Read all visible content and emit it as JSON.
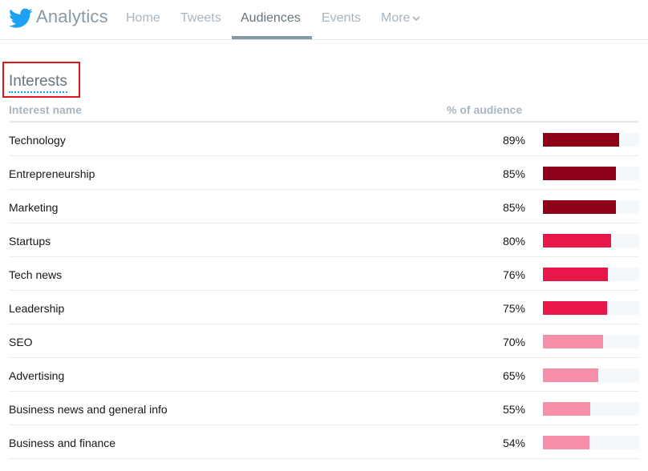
{
  "nav": {
    "brand": "Analytics",
    "links": [
      "Home",
      "Tweets",
      "Audiences",
      "Events",
      "More"
    ],
    "active": "Audiences"
  },
  "section": {
    "title": "Interests",
    "col_name": "Interest name",
    "col_pct": "% of audience"
  },
  "colors": {
    "dark": "#8f0018",
    "mid": "#e8174a",
    "light": "#f68fa8",
    "track": "#f5f8fa"
  },
  "interests": [
    {
      "name": "Technology",
      "pct_label": "89%",
      "value": 0.89,
      "tier": "dark"
    },
    {
      "name": "Entrepreneurship",
      "pct_label": "85%",
      "value": 0.85,
      "tier": "dark"
    },
    {
      "name": "Marketing",
      "pct_label": "85%",
      "value": 0.85,
      "tier": "dark"
    },
    {
      "name": "Startups",
      "pct_label": "80%",
      "value": 0.8,
      "tier": "mid"
    },
    {
      "name": "Tech news",
      "pct_label": "76%",
      "value": 0.76,
      "tier": "mid"
    },
    {
      "name": "Leadership",
      "pct_label": "75%",
      "value": 0.75,
      "tier": "mid"
    },
    {
      "name": "SEO",
      "pct_label": "70%",
      "value": 0.7,
      "tier": "light"
    },
    {
      "name": "Advertising",
      "pct_label": "65%",
      "value": 0.65,
      "tier": "light"
    },
    {
      "name": "Business news and general info",
      "pct_label": "55%",
      "value": 0.55,
      "tier": "light"
    },
    {
      "name": "Business and finance",
      "pct_label": "54%",
      "value": 0.54,
      "tier": "light"
    }
  ]
}
